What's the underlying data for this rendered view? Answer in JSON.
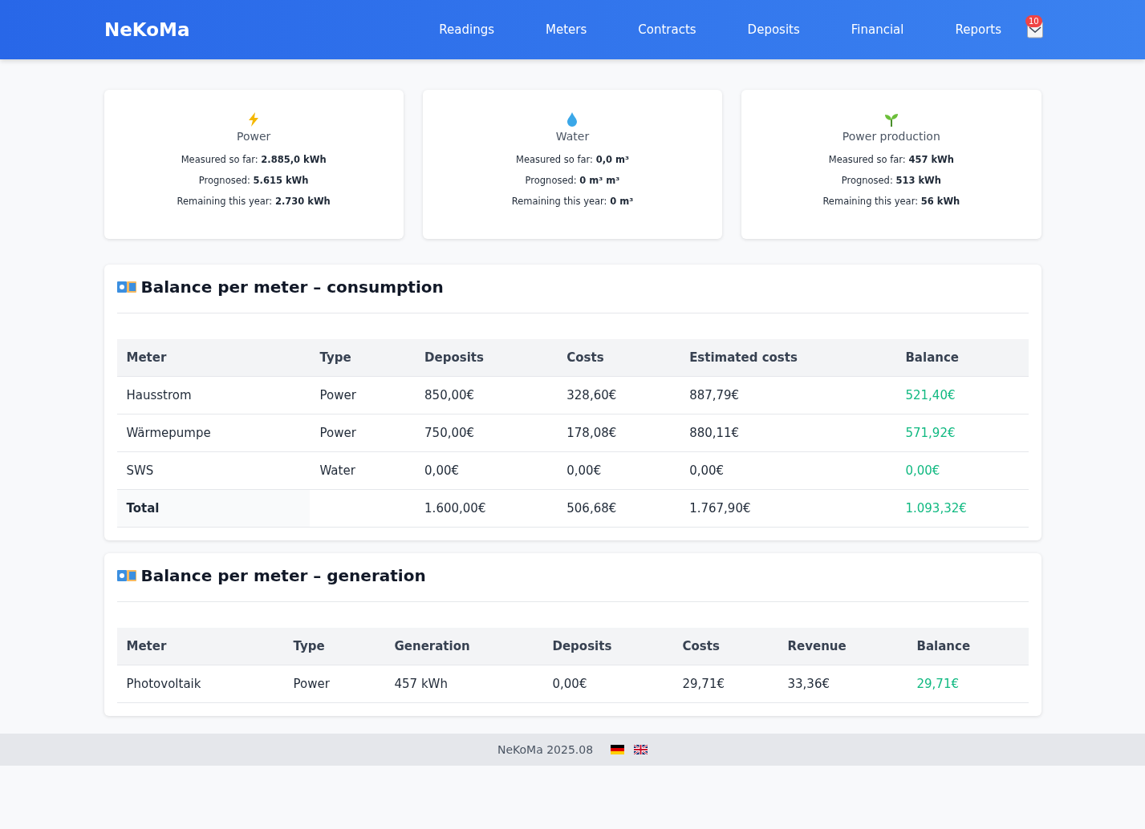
{
  "header": {
    "brand": "NeKoMa",
    "nav": [
      "Readings",
      "Meters",
      "Contracts",
      "Deposits",
      "Financial",
      "Reports"
    ],
    "notification_count": "10"
  },
  "summary_cards": [
    {
      "kind": "power",
      "title": "Power",
      "lines": [
        "Measured so far: **2.885,0 kWh**",
        "Prognosed: **5.615 kWh**",
        "Remaining this year: **2.730 kWh**"
      ]
    },
    {
      "kind": "water",
      "title": "Water",
      "lines": [
        "Measured so far: **0,0 m³**",
        "Prognosed: **0 m³ m³**",
        "Remaining this year: **0 m³**"
      ]
    },
    {
      "kind": "production",
      "title": "Power production",
      "lines": [
        "Measured so far: **457 kWh**",
        "Prognosed: **513 kWh**",
        "Remaining this year: **56 kWh**"
      ]
    }
  ],
  "tables": [
    {
      "title": "Balance per meter – consumption",
      "columns": [
        "Meter",
        "Type",
        "Deposits",
        "Costs",
        "Estimated costs",
        "Balance"
      ],
      "rows": [
        {
          "kind": "row",
          "cells": [
            "Hausstrom",
            "Power",
            "850,00€",
            "328,60€",
            "887,79€",
            "521,40€"
          ]
        },
        {
          "kind": "row",
          "cells": [
            "Wärmepumpe",
            "Power",
            "750,00€",
            "178,08€",
            "880,11€",
            "571,92€"
          ]
        },
        {
          "kind": "row",
          "cells": [
            "SWS",
            "Water",
            "0,00€",
            "0,00€",
            "0,00€",
            "0,00€"
          ]
        },
        {
          "kind": "total",
          "cells": [
            "Total",
            "",
            "1.600,00€",
            "506,68€",
            "1.767,90€",
            "1.093,32€"
          ]
        }
      ]
    },
    {
      "title": "Balance per meter – generation",
      "columns": [
        "Meter",
        "Type",
        "Generation",
        "Deposits",
        "Costs",
        "Revenue",
        "Balance"
      ],
      "rows": [
        {
          "kind": "row",
          "cells": [
            "Photovoltaik",
            "Power",
            "457 kWh",
            "0,00€",
            "29,71€",
            "33,36€",
            "29,71€"
          ]
        }
      ]
    }
  ],
  "footer": {
    "version": "NeKoMa 2025.08"
  }
}
